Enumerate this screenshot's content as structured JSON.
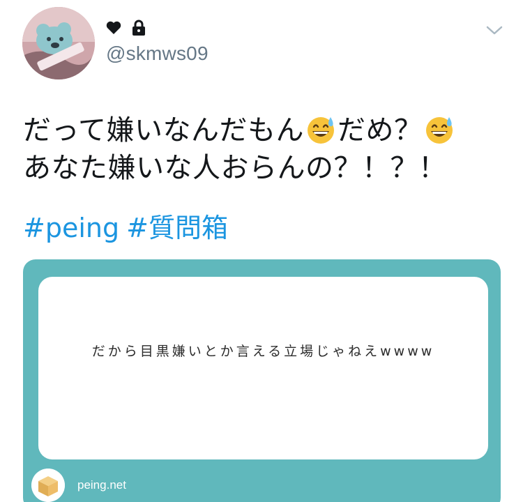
{
  "header": {
    "avatar_icon": "profile-avatar",
    "name_icons": [
      "heart-icon",
      "lock-icon"
    ],
    "handle": "@skmws09",
    "menu_icon": "chevron-down-icon"
  },
  "tweet": {
    "line1": [
      {
        "type": "text",
        "value": "だって嫌いなんだもん"
      },
      {
        "type": "emoji",
        "icon": "grinning-sweat-emoji"
      },
      {
        "type": "text",
        "value": "だめ？"
      },
      {
        "type": "emoji",
        "icon": "grinning-sweat-emoji"
      }
    ],
    "line2": "あなた嫌いな人おらんの？！？！",
    "hashtags": [
      "#peing",
      "#質問箱"
    ]
  },
  "card": {
    "question": "だから目黒嫌いとか言える立場じゃねえwwww",
    "domain": "peing.net",
    "logo_icon": "peing-box-icon",
    "colors": {
      "background": "#60b8bc",
      "inner": "#ffffff"
    }
  },
  "colors": {
    "text": "#14171a",
    "muted": "#657786",
    "link": "#1b95e0"
  }
}
